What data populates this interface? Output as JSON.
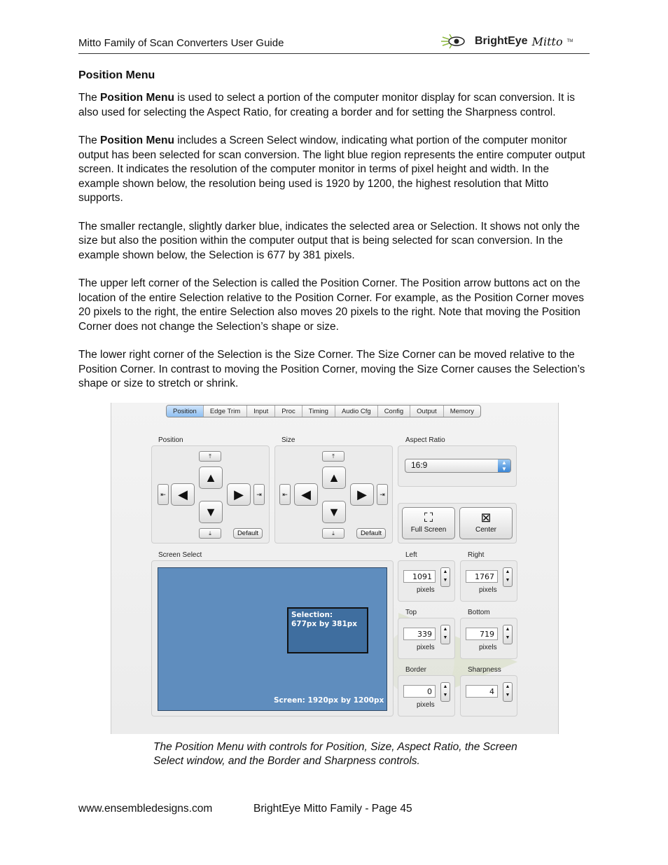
{
  "header": {
    "title": "Mitto Family of Scan Converters User Guide",
    "logo_word": "BrightEye",
    "logo_script": "Mitto",
    "logo_tm": "TM"
  },
  "section_title": "Position Menu",
  "paragraphs": [
    {
      "pre": "The ",
      "bold": "Position Menu",
      "post": " is used to select a portion of the computer monitor display for scan conversion. It is also used for selecting the Aspect Ratio, for creating a border and for setting the Sharpness control."
    },
    {
      "pre": "The ",
      "bold": "Position Menu",
      "post": " includes a Screen Select window, indicating what portion of the computer monitor output has been selected for scan conversion. The light blue region represents the entire computer output screen. It indicates the resolution of the computer monitor in terms of pixel height and width. In the example shown below, the resolution being used is 1920 by 1200, the highest resolution that Mitto supports."
    },
    {
      "text": "The smaller rectangle, slightly darker blue, indicates the selected area or Selection. It shows not only the size but also the position within the computer output that is being selected for scan conversion. In the example shown below, the Selection is 677 by 381 pixels."
    },
    {
      "text": "The upper left corner of the Selection is called the Position Corner. The Position arrow buttons act on the location of the entire Selection relative to the Position Corner. For example, as the Position Corner moves 20 pixels to the right, the entire Selection also moves 20 pixels to the right. Note that moving the Position Corner does not change the Selection’s shape or size."
    },
    {
      "text": "The lower right corner of the Selection is the Size Corner. The Size Corner can be moved relative to the Position Corner. In contrast to moving the Position Corner, moving the Size Corner causes the Selection’s shape or size to stretch or shrink."
    }
  ],
  "screenshot": {
    "tabs": [
      "Position",
      "Edge Trim",
      "Input",
      "Proc",
      "Timing",
      "Audio Cfg",
      "Config",
      "Output",
      "Memory"
    ],
    "position_label": "Position",
    "size_label": "Size",
    "default_label": "Default",
    "aspect_label": "Aspect Ratio",
    "aspect_value": "16:9",
    "full_screen_label": "Full Screen",
    "center_label": "Center",
    "screen_select_label": "Screen Select",
    "selection_title": "Selection:",
    "selection_size": "677px by 381px",
    "screen_text": "Screen: 1920px by 1200px",
    "pixels_unit": "pixels",
    "fields": {
      "left": {
        "label": "Left",
        "value": "1091"
      },
      "right": {
        "label": "Right",
        "value": "1767"
      },
      "top": {
        "label": "Top",
        "value": "339"
      },
      "bottom": {
        "label": "Bottom",
        "value": "719"
      },
      "border": {
        "label": "Border",
        "value": "0"
      },
      "sharpness": {
        "label": "Sharpness",
        "value": "4"
      }
    }
  },
  "caption": "The Position Menu with controls for Position, Size, Aspect Ratio, the Screen Select window, and the Border and Sharpness controls.",
  "footer": {
    "left": "www.ensembledesigns.com",
    "right": "BrightEye Mitto Family - Page 45"
  }
}
